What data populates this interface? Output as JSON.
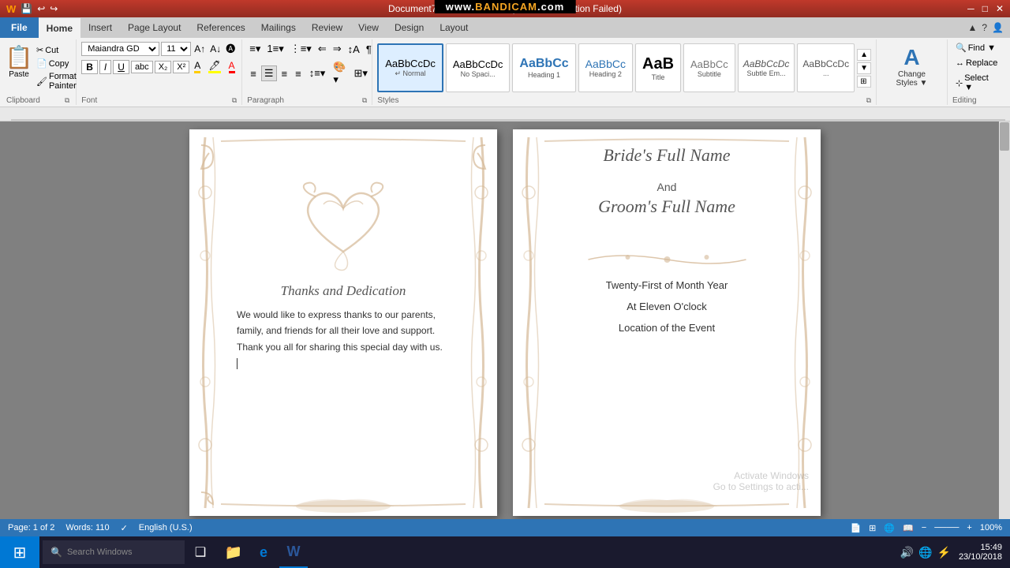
{
  "titlebar": {
    "title": "Document7 - Microsoft Word (Product Activation Failed)",
    "minimize": "─",
    "restore": "□",
    "close": "✕"
  },
  "bandicam": {
    "text": "www.BANDICAM.com"
  },
  "tabs": {
    "file": "File",
    "home": "Home",
    "insert": "Insert",
    "pageLayout": "Page Layout",
    "references": "References",
    "mailings": "Mailings",
    "review": "Review",
    "view": "View",
    "design": "Design",
    "layout": "Layout",
    "active": "Home"
  },
  "clipboard": {
    "paste": "Paste",
    "cut": "Cut",
    "copy": "Copy",
    "formatPainter": "Format Painter",
    "label": "Clipboard"
  },
  "font": {
    "family": "Maiandra GD",
    "size": "11",
    "bold": "B",
    "italic": "I",
    "underline": "U",
    "strikethrough": "abc",
    "subscript": "X₂",
    "superscript": "X²",
    "label": "Font"
  },
  "paragraph": {
    "label": "Paragraph"
  },
  "styles": {
    "label": "Styles",
    "items": [
      {
        "id": "normal",
        "preview": "AaBbCcDc",
        "label": "Normal",
        "active": true
      },
      {
        "id": "noSpacing",
        "preview": "AaBbCcDc",
        "label": "No Spaci..."
      },
      {
        "id": "heading1",
        "preview": "AaBbCc",
        "label": "Heading 1"
      },
      {
        "id": "heading2",
        "preview": "AaBbCc",
        "label": "Heading 2"
      },
      {
        "id": "title",
        "preview": "AaB",
        "label": "Title"
      },
      {
        "id": "subtitle",
        "preview": "AaBbCc",
        "label": "Subtitle"
      },
      {
        "id": "subtleEm",
        "preview": "AaBbCcDc",
        "label": "Subtle Em..."
      },
      {
        "id": "more",
        "preview": "AaBbCcDc",
        "label": "..."
      }
    ]
  },
  "changeStyles": {
    "icon": "A",
    "label": "Change\nStyles ▼"
  },
  "editing": {
    "label": "Editing",
    "find": "Find ▼",
    "replace": "Replace",
    "select": "Select ▼"
  },
  "leftPage": {
    "thanksHeading": "Thanks and Dedication",
    "body1": "We would like to express thanks to our parents,",
    "body2": "family, and friends for all their love and support.",
    "body3": "Thank you all for sharing this special day with us."
  },
  "rightPage": {
    "brideName": "Bride's Full Name",
    "and": "And",
    "groomName": "Groom's Full Name",
    "date": "Twenty-First of Month Year",
    "time": "At Eleven O'clock",
    "location": "Location of the Event"
  },
  "watermark": {
    "line1": "Activate Windows",
    "line2": "Go to Settings to acti..."
  },
  "statusBar": {
    "page": "Page: 1 of 2",
    "words": "Words: 110",
    "language": "English (U.S.)",
    "zoom": "100%"
  },
  "taskbar": {
    "time": "15:49",
    "date": "23/10/2018",
    "startIcon": "⊞",
    "searchIcon": "🔍",
    "taskviewIcon": "❑",
    "explorerIcon": "📁",
    "edgeIcon": "e",
    "wordIcon": "W",
    "sysTrayIcons": [
      "🔊",
      "🌐",
      "⚡"
    ]
  }
}
